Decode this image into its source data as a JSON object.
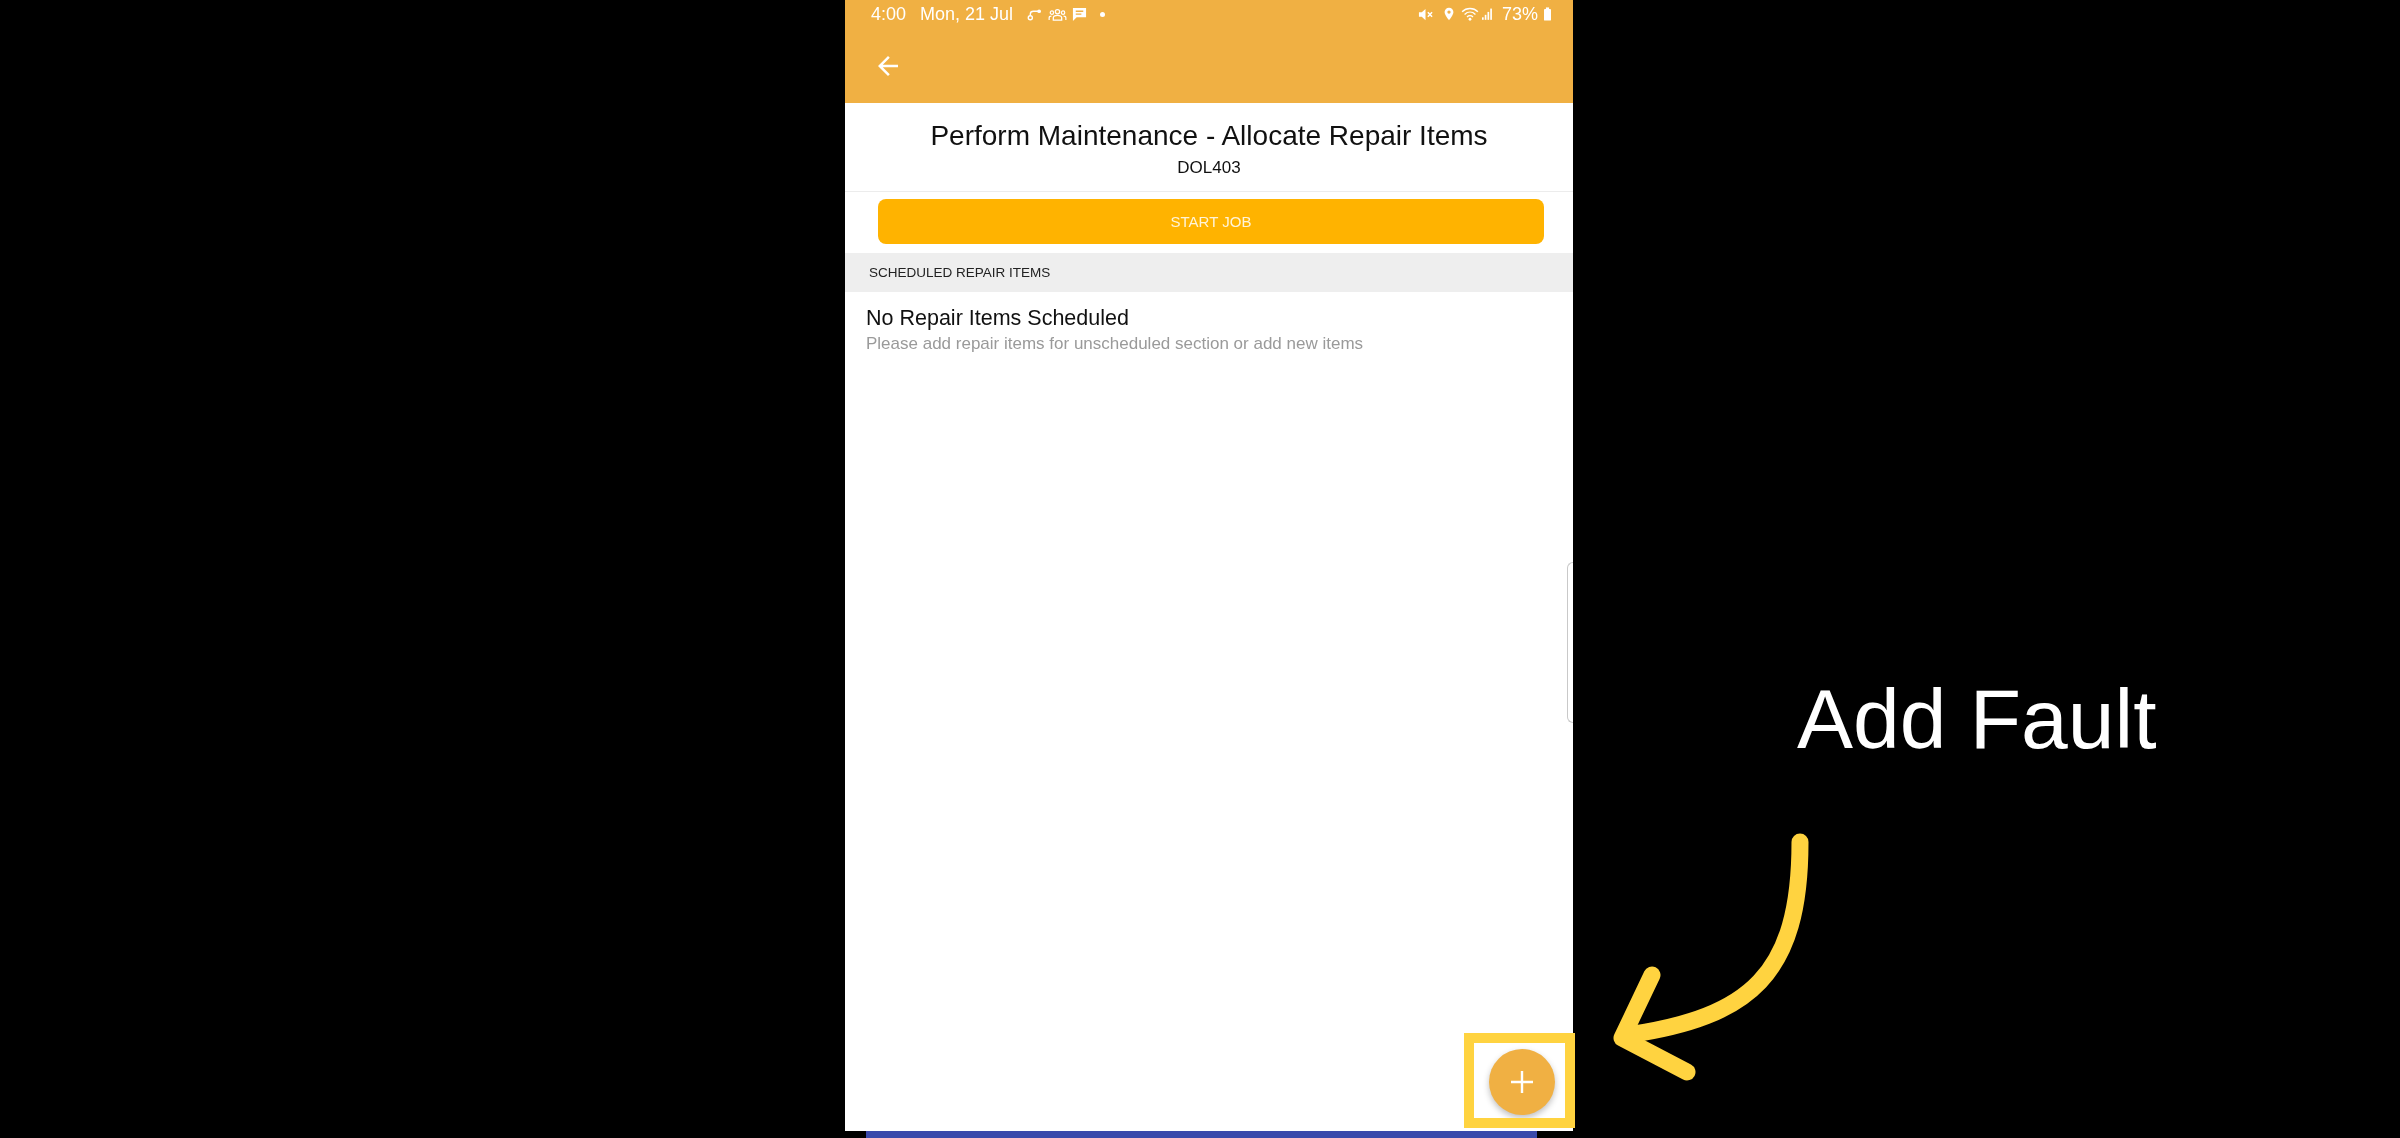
{
  "status_bar": {
    "time": "4:00",
    "date": "Mon, 21 Jul",
    "battery": "73%"
  },
  "header": {
    "title": "Perform Maintenance - Allocate Repair Items",
    "subtitle": "DOL403"
  },
  "start_button": {
    "label": "START JOB"
  },
  "scheduled_section": {
    "title": "SCHEDULED REPAIR ITEMS",
    "empty_state": {
      "title": "No Repair Items Scheduled",
      "message": "Please add repair items for unscheduled section or add new items"
    }
  },
  "callout": {
    "label": "Add Fault"
  }
}
